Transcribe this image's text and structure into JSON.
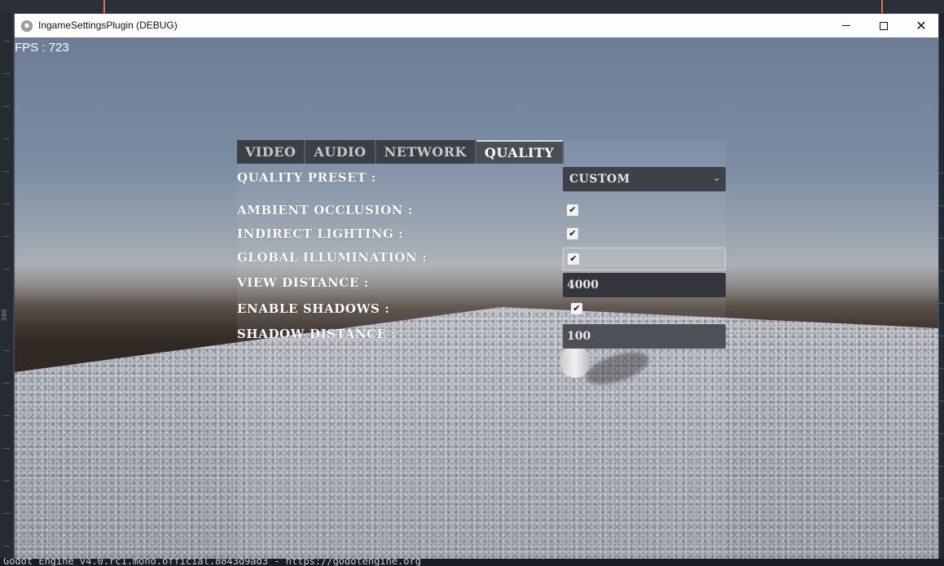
{
  "window": {
    "title": "IngameSettingsPlugin (DEBUG)",
    "minimize_icon": "minimize-icon",
    "maximize_icon": "maximize-icon",
    "close_glyph": "✕"
  },
  "hud": {
    "fps": "FPS : 723"
  },
  "tabs": [
    {
      "label": "VIDEO",
      "active": false
    },
    {
      "label": "AUDIO",
      "active": false
    },
    {
      "label": "NETWORK",
      "active": false
    },
    {
      "label": "QUALITY",
      "active": true
    }
  ],
  "quality": {
    "preset_label": "QUALITY PRESET :",
    "preset_value": "CUSTOM",
    "ambient_occlusion_label": "AMBIENT OCCLUSION :",
    "ambient_occlusion": true,
    "indirect_lighting_label": "INDIRECT LIGHTING :",
    "indirect_lighting": true,
    "global_illumination_label": "GLOBAL ILLUMINATION :",
    "global_illumination": true,
    "view_distance_label": "VIEW DISTANCE :",
    "view_distance": "4000",
    "enable_shadows_label": "ENABLE SHADOWS :",
    "enable_shadows": true,
    "shadow_distance_label": "SHADOW DISTANCE :",
    "shadow_distance": "100",
    "check_glyph": "✔"
  },
  "editor": {
    "ruler_label": "500",
    "status_text": "Godot Engine v4.0.rc1.mono.official.8843d9ad3 - https://godotengine.org"
  },
  "colors": {
    "accent_marker": "#e8734a",
    "panel_tab": "#3b3f46",
    "field": "#33363c"
  }
}
